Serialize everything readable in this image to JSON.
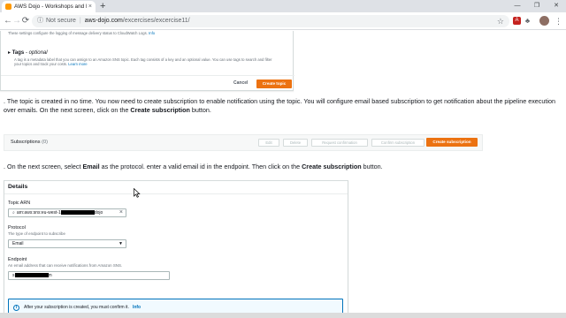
{
  "browser": {
    "tab_title": "AWS Dojo - Workshops and Exerc",
    "tab_close": "×",
    "new_tab": "+",
    "win_minimize": "—",
    "win_maximize": "❐",
    "win_close": "✕",
    "back": "←",
    "forward": "→",
    "reload": "⟳",
    "info_icon": "ⓘ",
    "not_secure": "Not secure",
    "separator": "|",
    "url_host": "aws-dojo.com",
    "url_path": "/excercises/excercise11/",
    "star": "☆",
    "menu": "⋮",
    "extensions": [
      {
        "name": "pdf-ext-icon",
        "label": "A",
        "color": "#c5221f"
      },
      {
        "name": "bookmark-ext-icon",
        "label": "♣",
        "color": "#5f6368"
      },
      {
        "name": "puzzle-ext-icon",
        "label": "✚",
        "color": "#5f6368"
      },
      {
        "name": "download-ext-icon",
        "label": "⇩",
        "color": "#5f6368"
      }
    ]
  },
  "panel1": {
    "clipped_text": "These settings configure the logging of message delivery status to CloudWatch Logs.",
    "clipped_link": "Info",
    "tags_arrow": "▸",
    "tags_label": "Tags",
    "tags_optional": "- optional",
    "tags_desc": "A tag is a metadata label that you can assign to an Amazon SNS topic. Each tag consists of a key and an optional value. You can use tags to search and filter your topics and track your costs.",
    "tags_link": "Learn more",
    "cancel": "Cancel",
    "create_topic": "Create topic"
  },
  "step1": {
    "text_before": ". The topic is created in no time. You now need to create subscription to enable notification using the topic. You will configure email based subscription to get notification about the pipeline execution over emails. On the next screen, click on the ",
    "bold": "Create subscription",
    "text_after": " button."
  },
  "subscriptions": {
    "title": "Subscriptions",
    "count": "(0)",
    "buttons": [
      "Edit",
      "Delete",
      "Request confirmation",
      "Confirm subscription"
    ],
    "create": "Create subscription"
  },
  "step2": {
    "t1": ". On the next screen, select ",
    "b1": "Email",
    "t2": " as the protocol. enter a valid email id in the endpoint. Then click on the ",
    "b2": "Create subscription",
    "t3": " button."
  },
  "details": {
    "title": "Details",
    "topic_arn_label": "Topic ARN",
    "topic_arn_prefix": "arn:aws:sns:eu-west-1",
    "topic_arn_suffix": "dojo",
    "protocol_label": "Protocol",
    "protocol_desc": "The type of endpoint to subscribe",
    "protocol_value": "Email",
    "endpoint_label": "Endpoint",
    "endpoint_desc": "An email address that can receive notifications from Amazon SNS.",
    "endpoint_prefix": "s",
    "endpoint_suffix": "m",
    "info_text": "After your subscription is created, you must confirm it.",
    "info_link": "Info"
  },
  "colors": {
    "accent": "#ec7211",
    "link": "#0073bb",
    "border": "#d5dbdb"
  }
}
